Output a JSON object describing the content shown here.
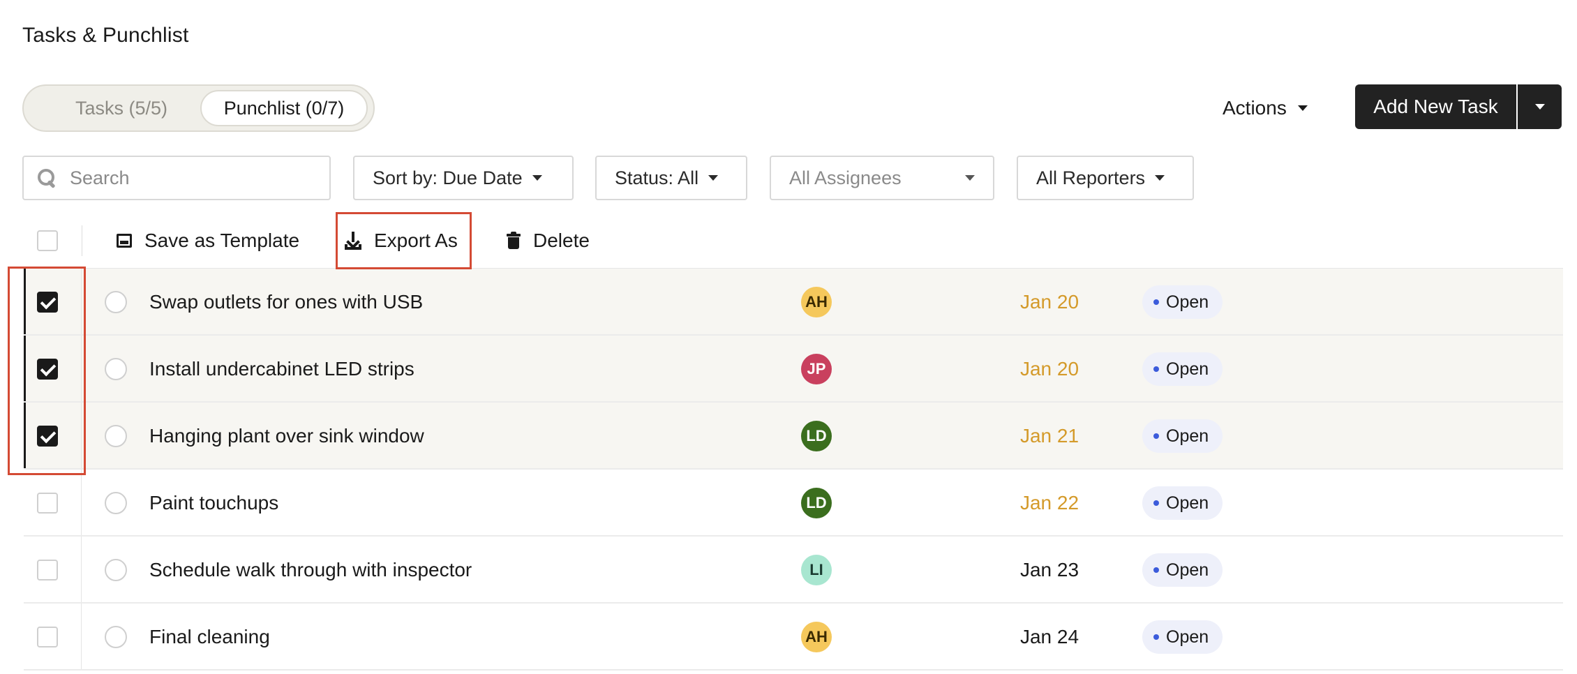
{
  "page": {
    "title": "Tasks & Punchlist"
  },
  "tabs": [
    {
      "label": "Tasks (5/5)",
      "active": false
    },
    {
      "label": "Punchlist (0/7)",
      "active": true
    }
  ],
  "header_actions": {
    "actions_label": "Actions",
    "add_task_label": "Add New Task"
  },
  "filters": {
    "search_placeholder": "Search",
    "sort_label": "Sort by: Due Date",
    "status_label": "Status: All",
    "assignees_placeholder": "All Assignees",
    "reporters_label": "All Reporters"
  },
  "bulk_actions": {
    "save_template": "Save as Template",
    "export_as": "Export As",
    "delete": "Delete"
  },
  "rows": [
    {
      "name": "Swap outlets for ones with USB",
      "assignee": "AH",
      "avatar_bg": "#f5c85c",
      "avatar_fg": "#3a2a00",
      "due": "Jan 20",
      "due_color": "#d49a2a",
      "status": "Open",
      "selected": true
    },
    {
      "name": "Install undercabinet LED strips",
      "assignee": "JP",
      "avatar_bg": "#c9405e",
      "avatar_fg": "#ffffff",
      "due": "Jan 20",
      "due_color": "#d49a2a",
      "status": "Open",
      "selected": true
    },
    {
      "name": "Hanging plant over sink window",
      "assignee": "LD",
      "avatar_bg": "#3b6e1e",
      "avatar_fg": "#ffffff",
      "due": "Jan 21",
      "due_color": "#d49a2a",
      "status": "Open",
      "selected": true
    },
    {
      "name": "Paint touchups",
      "assignee": "LD",
      "avatar_bg": "#3b6e1e",
      "avatar_fg": "#ffffff",
      "due": "Jan 22",
      "due_color": "#d49a2a",
      "status": "Open",
      "selected": false
    },
    {
      "name": "Schedule walk through with inspector",
      "assignee": "LI",
      "avatar_bg": "#a8e6d0",
      "avatar_fg": "#1a3a30",
      "due": "Jan 23",
      "due_color": "#1a1a1a",
      "status": "Open",
      "selected": false
    },
    {
      "name": "Final cleaning",
      "assignee": "AH",
      "avatar_bg": "#f5c85c",
      "avatar_fg": "#3a2a00",
      "due": "Jan 24",
      "due_color": "#1a1a1a",
      "status": "Open",
      "selected": false
    }
  ],
  "colors": {
    "highlight": "#d44a34",
    "primary_button": "#222222",
    "status_dot": "#3b5bdb"
  }
}
